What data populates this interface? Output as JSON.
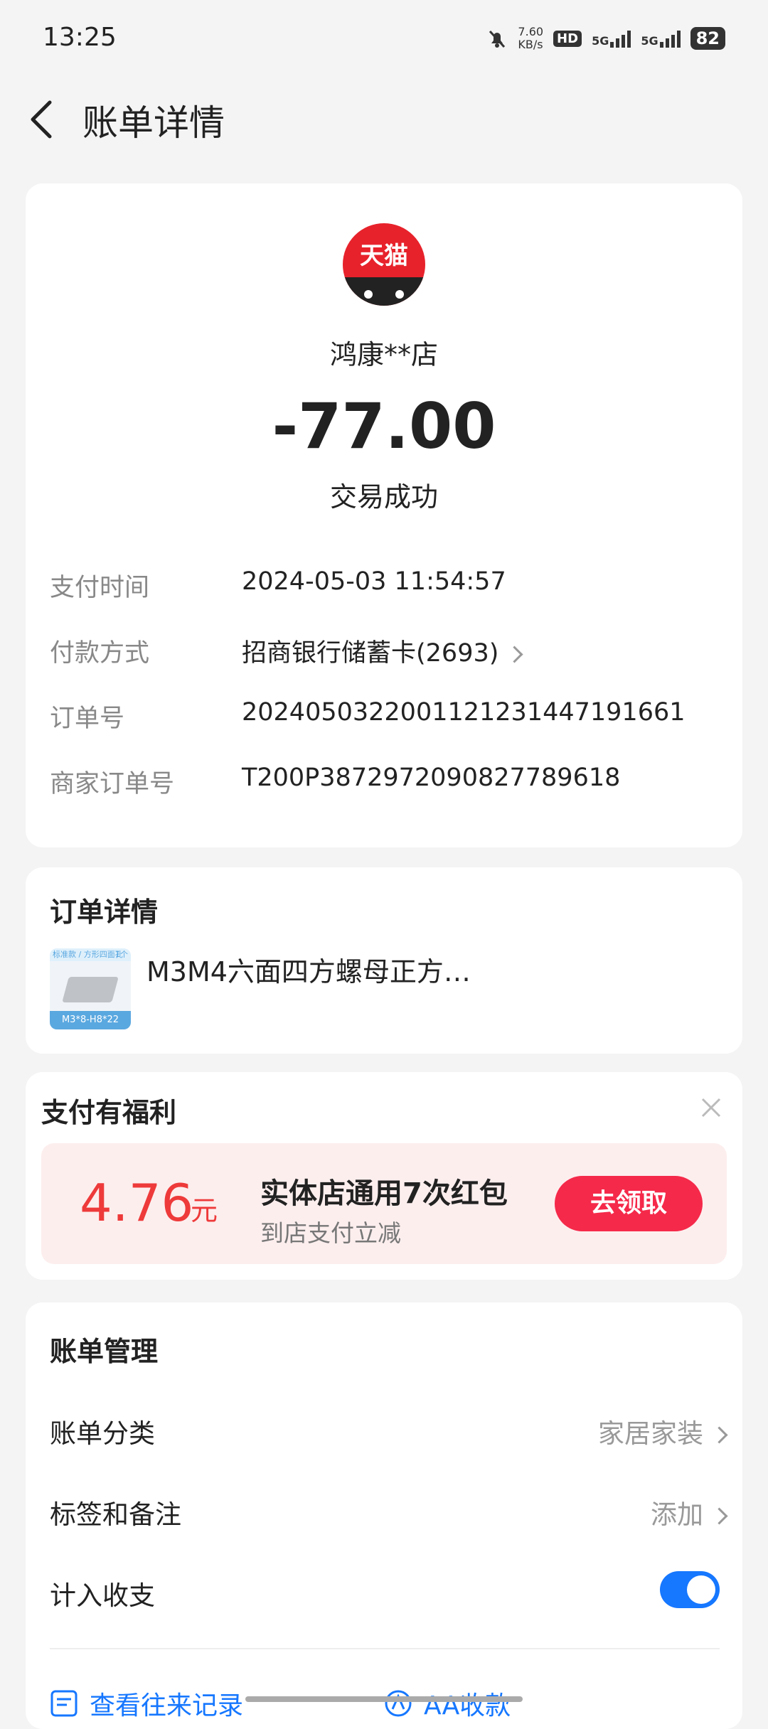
{
  "status_bar": {
    "time": "13:25",
    "net_speed_top": "7.60",
    "net_speed_bottom": "KB/s",
    "hd": "HD",
    "signal1": "5G",
    "signal2": "5G",
    "battery": "82"
  },
  "header": {
    "title": "账单详情"
  },
  "merchant": {
    "logo_text": "天猫",
    "name": "鸿康**店",
    "amount": "-77.00",
    "status": "交易成功"
  },
  "details": [
    {
      "label": "支付时间",
      "value": "2024-05-03 11:54:57"
    },
    {
      "label": "付款方式",
      "value": "招商银行储蓄卡(2693)"
    },
    {
      "label": "订单号",
      "value": "2024050322001121231447191661"
    },
    {
      "label": "商家订单号",
      "value": "T200P3872972090827789618"
    }
  ],
  "order": {
    "title": "订单详情",
    "product_name": "M3M4六面四方螺母正方…",
    "thumb_top": "标准款 / 方形四面孔",
    "thumb_badge": "1个",
    "thumb_label": "M3*8-H8*22"
  },
  "benefit": {
    "title": "支付有福利",
    "amount": "4.76",
    "unit": "元",
    "coupon_title": "实体店通用7次红包",
    "coupon_sub": "到店支付立减",
    "button": "去领取"
  },
  "manage": {
    "title": "账单管理",
    "category_label": "账单分类",
    "category_value": "家居家装",
    "tags_label": "标签和备注",
    "tags_value": "添加",
    "include_label": "计入收支",
    "include_on": true,
    "link1": "查看往来记录",
    "link2": "AA收款"
  },
  "colors": {
    "accent": "#1677ff",
    "red": "#f5294a",
    "tmall": "#e7222b"
  }
}
